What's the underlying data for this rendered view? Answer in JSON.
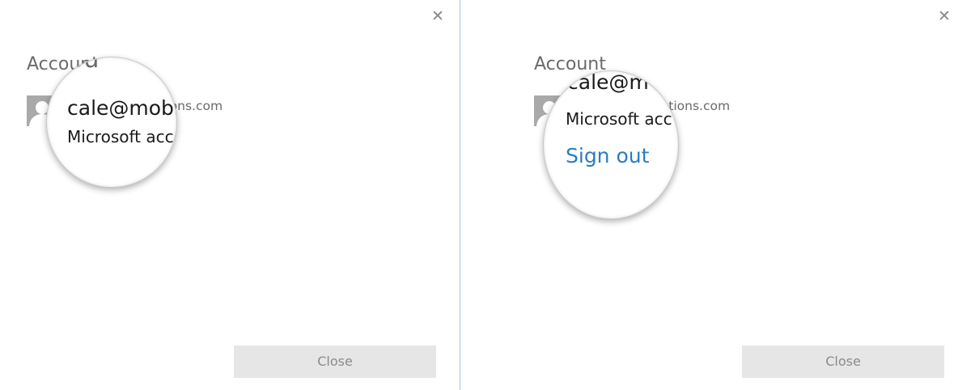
{
  "dialogs": [
    {
      "heading": "Account",
      "email": "cale@mobilenations.com",
      "account_type": "Microsoft account",
      "close_glyph": "✕",
      "close_button": "Close",
      "magnifier": {
        "heading_fragment": "Accou",
        "email_fragment": "cale@mobi",
        "type_fragment": "Microsoft acc"
      }
    },
    {
      "heading": "Account",
      "email": "cale@mobilenations.com",
      "account_type": "Microsoft account",
      "close_glyph": "✕",
      "close_button": "Close",
      "magnifier": {
        "email_fragment": "cale@m",
        "type_fragment": "Microsoft acc",
        "sign_out": "Sign out"
      }
    }
  ],
  "colors": {
    "divider": "#9ec4e0",
    "link": "#2a7cc6",
    "button_bg": "#e6e6e6"
  },
  "icons": {
    "avatar": "person-silhouette",
    "close": "close-x"
  }
}
